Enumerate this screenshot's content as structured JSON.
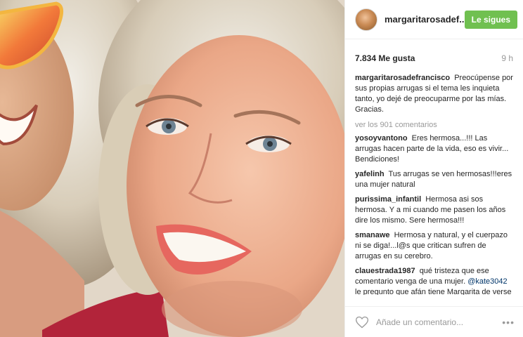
{
  "post": {
    "username": "margaritarosadef...",
    "follow_label": "Le sigues",
    "likes": "7.834 Me gusta",
    "age": "9 h",
    "caption": {
      "user": "margaritarosadefrancisco",
      "text": "Preocúpense por sus propias arrugas si el tema les inquieta tanto, yo dejé de preocuparme por las mías. Gracias."
    },
    "view_all": "ver los 901 comentarios",
    "comments": [
      {
        "user": "yosoyvantono",
        "text": "Eres hermosa...!!! Las arrugas hacen parte de la vida, eso es vivir... Bendiciones!"
      },
      {
        "user": "yafelinh",
        "text": "Tus arrugas se ven hermosas!!!eres una mujer natural"
      },
      {
        "user": "purissima_infantil",
        "text": "Hermosa asi sos hermosa. Y a mi cuando me pasen los años dire los mismo. Sere hermosa!!!"
      },
      {
        "user": "smanawe",
        "text": "Hermosa y natural, y el cuerpazo ni se diga!...l@s que critican sufren de arrugas en su cerebro."
      },
      {
        "user": "clauestrada1987",
        "text": "qué tristeza que ese comentario venga de una mujer.",
        "mention": "@kate3042",
        "text2": "le pregunto que afán tiene Margarita de verse como muchacha? ella"
      }
    ],
    "comment_placeholder": "Añade un comentario...",
    "more_label": "•••"
  },
  "colors": {
    "follow_button": "#70c050",
    "muted_text": "#999999",
    "mention": "#003569"
  },
  "icons": {
    "like": "heart-outline-icon",
    "options": "more-options-icon"
  }
}
